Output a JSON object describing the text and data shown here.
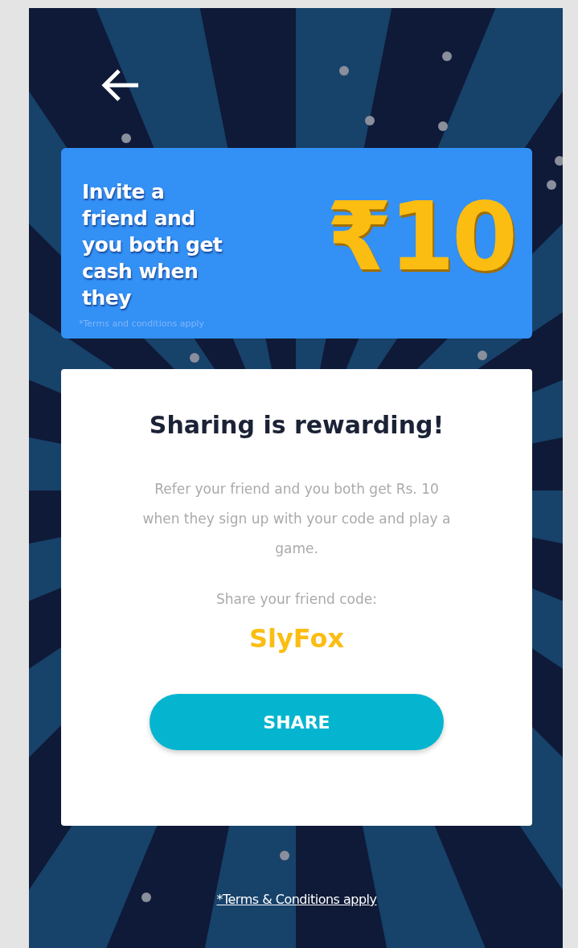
{
  "banner": {
    "headline": "Invite a friend and you both get cash when they",
    "amount": "₹10",
    "fine_print": "*Terms and conditions apply"
  },
  "card": {
    "title": "Sharing is rewarding!",
    "description": "Refer your friend and you both get Rs. 10 when they sign up with your code and play a game.",
    "code_label": "Share your friend code:",
    "code": "SlyFox",
    "button": "SHARE"
  },
  "footer": {
    "terms_link": "*Terms & Conditions apply"
  }
}
